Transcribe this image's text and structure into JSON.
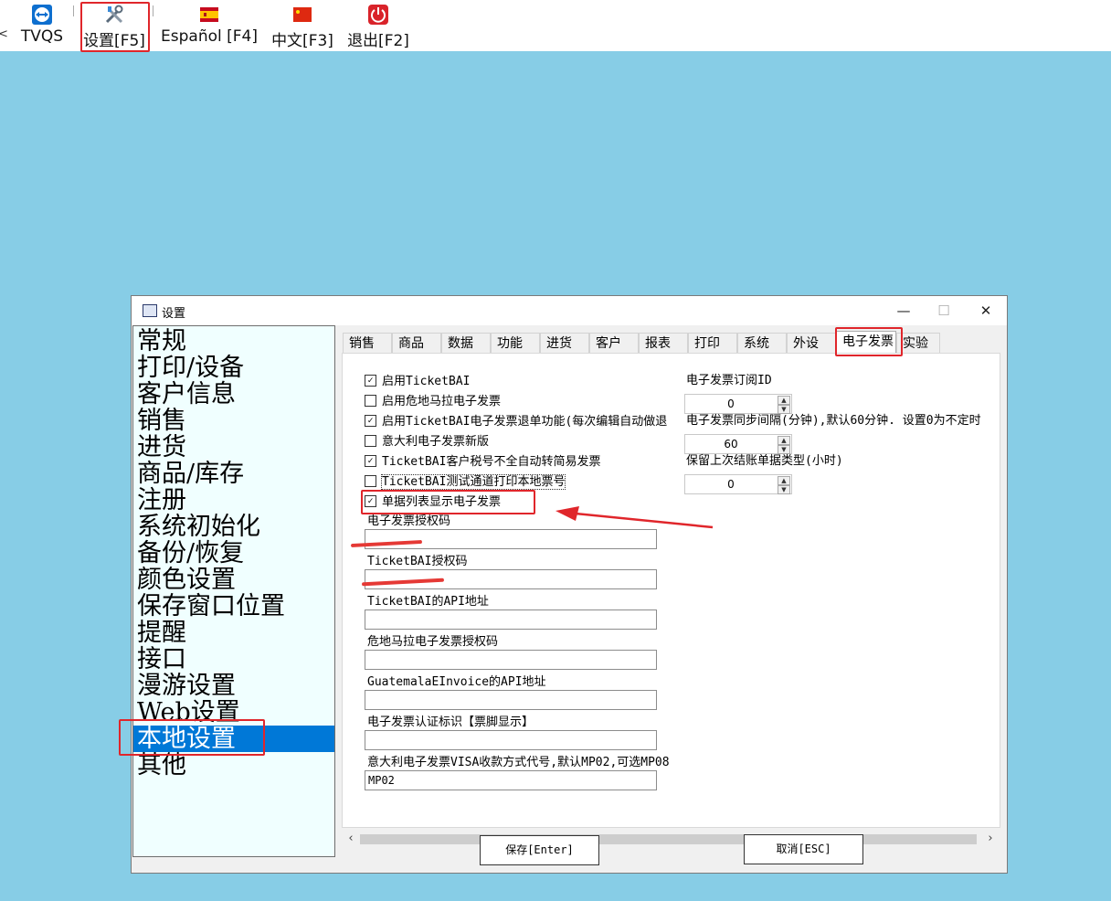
{
  "toolbar": {
    "partial_label": "<",
    "items": [
      {
        "label": "TVQS",
        "icon": "teamviewer-icon"
      },
      {
        "label": "设置[F5]",
        "icon": "settings-tools-icon"
      },
      {
        "label": "Español [F4]",
        "icon": "spain-flag-icon"
      },
      {
        "label": "中文[F3]",
        "icon": "china-flag-icon"
      },
      {
        "label": "退出[F2]",
        "icon": "power-icon"
      }
    ]
  },
  "dialog": {
    "title": "设置",
    "controls": {
      "minimize": "—",
      "maximize": "☐",
      "close": "✕"
    }
  },
  "nav": {
    "items": [
      "常规",
      "打印/设备",
      "客户信息",
      "销售",
      "进货",
      "商品/库存",
      "注册",
      "系统初始化",
      "备份/恢复",
      "颜色设置",
      "保存窗口位置",
      "提醒",
      "接口",
      "漫游设置",
      "Web设置",
      "本地设置",
      "其他"
    ],
    "selected_index": 15
  },
  "tabs": {
    "items": [
      "销售",
      "商品",
      "数据",
      "功能",
      "进货",
      "客户",
      "报表",
      "打印",
      "系统",
      "外设",
      "电子发票",
      "实验"
    ],
    "active_index": 10
  },
  "checkboxes": [
    {
      "label": "启用TicketBAI",
      "checked": true
    },
    {
      "label": "启用危地马拉电子发票",
      "checked": false
    },
    {
      "label": "启用TicketBAI电子发票退单功能(每次编辑自动做退",
      "checked": true
    },
    {
      "label": "意大利电子发票新版",
      "checked": false
    },
    {
      "label": "TicketBAI客户税号不全自动转简易发票",
      "checked": true
    },
    {
      "label": "TicketBAI测试通道打印本地票号",
      "checked": false
    },
    {
      "label": "单据列表显示电子发票",
      "checked": true
    }
  ],
  "fields": [
    {
      "label": "电子发票授权码",
      "value": ""
    },
    {
      "label": "TicketBAI授权码",
      "value": ""
    },
    {
      "label": "TicketBAI的API地址",
      "value": ""
    },
    {
      "label": "危地马拉电子发票授权码",
      "value": ""
    },
    {
      "label": "GuatemalaEInvoice的API地址",
      "value": ""
    },
    {
      "label": "电子发票认证标识【票脚显示】",
      "value": ""
    },
    {
      "label": "意大利电子发票VISA收款方式代号,默认MP02,可选MP08",
      "value": "MP02"
    }
  ],
  "right_settings": [
    {
      "label": "电子发票订阅ID",
      "value": "0"
    },
    {
      "label": "电子发票同步间隔(分钟),默认60分钟. 设置0为不定时",
      "value": "60"
    },
    {
      "label": "保留上次结账单据类型(小时)",
      "value": "0"
    }
  ],
  "buttons": {
    "save": "保存[Enter]",
    "cancel": "取消[ESC]"
  },
  "highlight_color": "#e0262b"
}
